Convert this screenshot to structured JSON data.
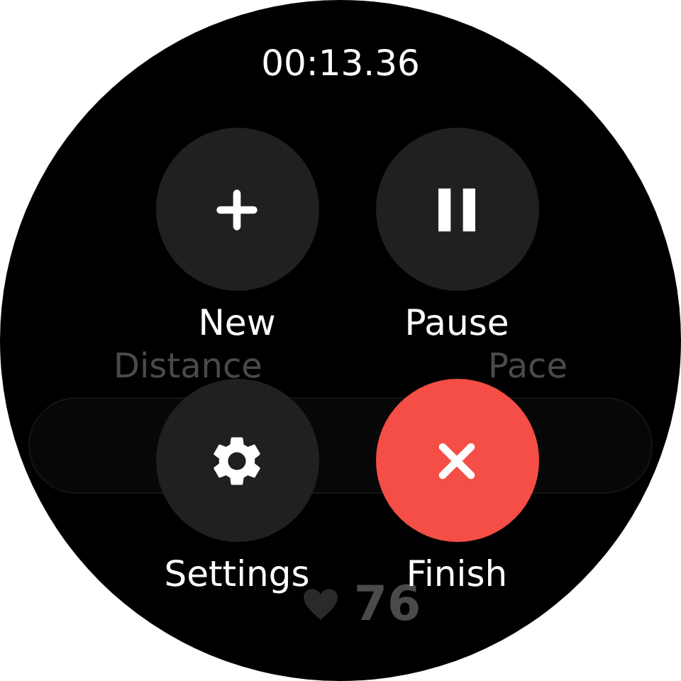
{
  "timer": "00:13.36",
  "background": {
    "labels": [
      "Distance",
      "Pace"
    ],
    "heart_rate": "76"
  },
  "actions": [
    {
      "label": "New",
      "kind": "new",
      "selected": false
    },
    {
      "label": "Pause",
      "kind": "pause",
      "selected": false
    },
    {
      "label": "Settings",
      "kind": "settings",
      "selected": false
    },
    {
      "label": "Finish",
      "kind": "finish",
      "selected": true
    }
  ]
}
